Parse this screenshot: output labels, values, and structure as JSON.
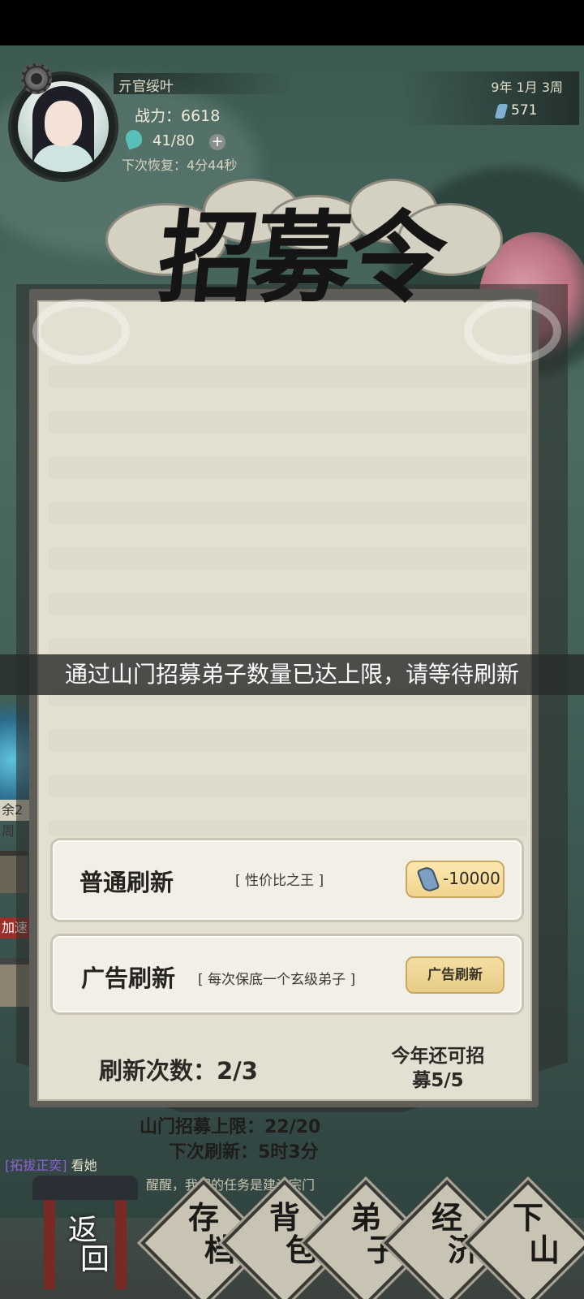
{
  "player": {
    "name": "亓官绥叶",
    "power": "战力：6618",
    "stamina": "41/80",
    "plus_icon": "+",
    "recover": "下次恢复：4分44秒"
  },
  "resources": {
    "date": "9年 1月 3周",
    "gems": "571"
  },
  "panel": {
    "title": "招募令",
    "toast": "通过山门招募弟子数量已达上限，请等待刷新",
    "options": [
      {
        "title": "普通刷新",
        "desc": "[ 性价比之王 ]",
        "button": "-10000"
      },
      {
        "title": "广告刷新",
        "desc": "[ 每次保底一个玄级弟子 ]",
        "button": "广告刷新"
      }
    ],
    "refresh_count": "刷新次数：2/3",
    "year_left_line1": "今年还可招",
    "year_left_line2": "募5/5"
  },
  "footer": {
    "limit": "山门招募上限：22/20",
    "next_refresh": "下次刷新：5时3分",
    "chat_tag": "[拓拔正奕]",
    "chat_line1": "看她",
    "chat_line2": "是你的！醒醒，我们的任务是建设宗门"
  },
  "left_edge": {
    "tag1": "余2周",
    "tag2": "加速"
  },
  "nav": {
    "back": [
      "返",
      "回"
    ],
    "save": [
      "存",
      "档"
    ],
    "bag": [
      "背",
      "包"
    ],
    "disciples": [
      "弟",
      "子"
    ],
    "economy": [
      "经",
      "济"
    ],
    "descend": [
      "下",
      "山"
    ]
  },
  "colors": {
    "paper": "#e4e0d1",
    "gold_button": "#f1d48e",
    "toast_bg": "#282c2a",
    "chat_tag": "#8f62d8"
  }
}
